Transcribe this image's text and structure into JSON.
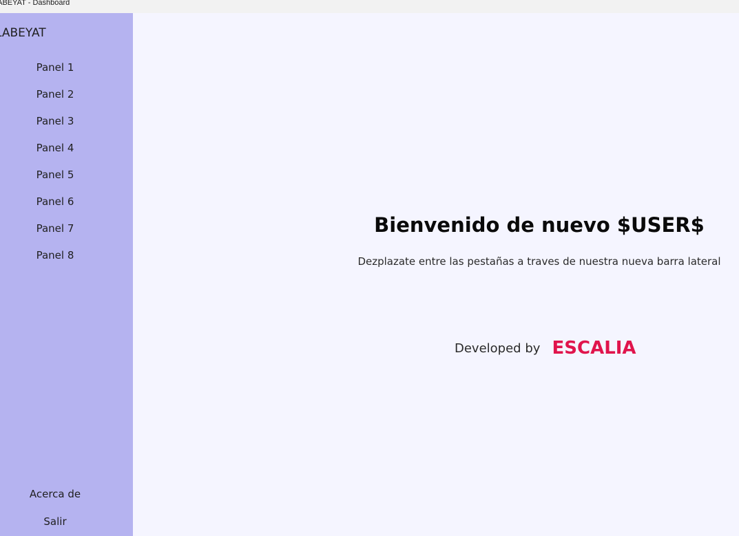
{
  "window": {
    "title": "LABEYAT - Dashboard"
  },
  "sidebar": {
    "app_name": "LABEYAT",
    "items": [
      {
        "label": "Panel 1"
      },
      {
        "label": "Panel 2"
      },
      {
        "label": "Panel 3"
      },
      {
        "label": "Panel 4"
      },
      {
        "label": "Panel 5"
      },
      {
        "label": "Panel 6"
      },
      {
        "label": "Panel 7"
      },
      {
        "label": "Panel 8"
      }
    ],
    "footer_items": [
      {
        "label": "Acerca de"
      },
      {
        "label": "Salir"
      }
    ]
  },
  "main": {
    "welcome": "Bienvenido de nuevo $USER$",
    "subtitle": "Dezplazate entre las pestañas a traves de nuestra nueva barra lateral",
    "credit_label": "Developed by",
    "credit_brand": "ESCALIA"
  },
  "colors": {
    "sidebar_bg": "#b5b3f0",
    "main_bg": "#f5f5ff",
    "brand": "#e0144c"
  }
}
